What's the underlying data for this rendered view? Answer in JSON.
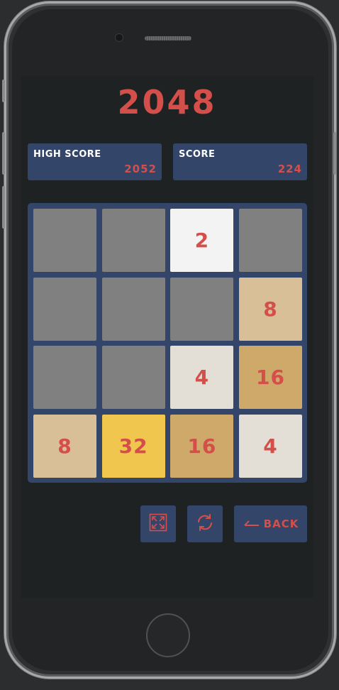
{
  "game": {
    "title": "2048"
  },
  "scores": {
    "high_score_label": "HIGH SCORE",
    "high_score_value": "2052",
    "score_label": "SCORE",
    "score_value": "224"
  },
  "board": {
    "rows": [
      [
        "",
        "",
        "2",
        ""
      ],
      [
        "",
        "",
        "",
        "8"
      ],
      [
        "",
        "",
        "4",
        "16"
      ],
      [
        "8",
        "32",
        "16",
        "4"
      ]
    ],
    "tile_colors": {
      "": "#808080",
      "2": "#f3f3f3",
      "4": "#e3ded6",
      "8": "#d9bf97",
      "16": "#cfa96a",
      "32": "#f0c64e"
    },
    "text_color": "#d44f4a"
  },
  "controls": {
    "fullscreen_icon": "expand-icon",
    "restart_icon": "refresh-icon",
    "back_icon": "arrow-left-icon",
    "back_label": "BACK"
  },
  "colors": {
    "accent": "#d44f4a",
    "panel": "#34456a",
    "screen_bg": "#1f2223"
  }
}
